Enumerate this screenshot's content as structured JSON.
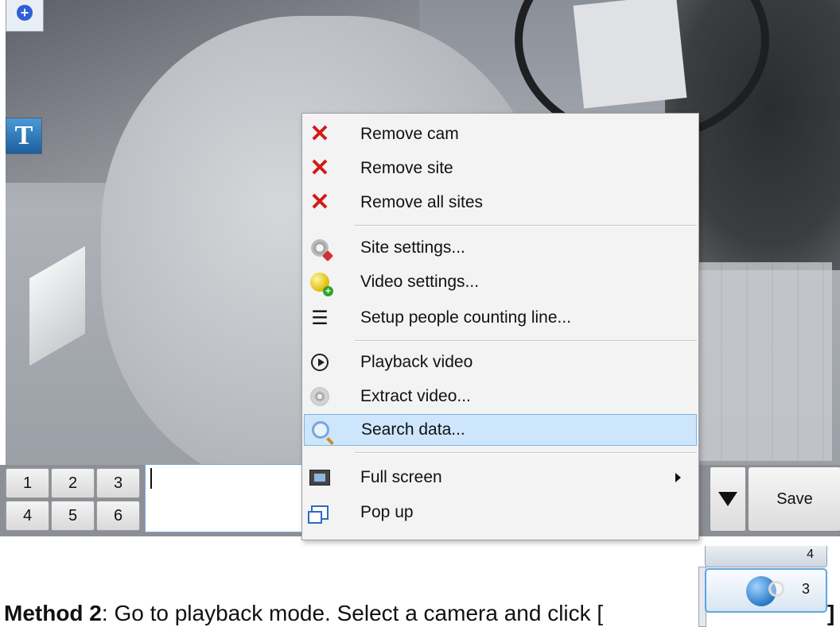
{
  "viewport": {
    "zoom_icon_symbol": "+",
    "text_tool_label": "T"
  },
  "context_menu": {
    "items": [
      {
        "label": "Remove cam",
        "icon": "close-icon"
      },
      {
        "label": "Remove site",
        "icon": "close-icon"
      },
      {
        "label": "Remove all sites",
        "icon": "close-icon"
      },
      {
        "label": "Site settings...",
        "icon": "gear-icon"
      },
      {
        "label": "Video settings...",
        "icon": "video-settings-icon"
      },
      {
        "label": "Setup people counting line...",
        "icon": "numbered-list-icon"
      },
      {
        "label": "Playback video",
        "icon": "play-icon"
      },
      {
        "label": "Extract video...",
        "icon": "disc-icon"
      },
      {
        "label": "Search data...",
        "icon": "search-icon"
      },
      {
        "label": "Full screen",
        "icon": "fullscreen-icon"
      },
      {
        "label": "Pop up",
        "icon": "popup-icon"
      }
    ],
    "highlighted": "Search data...",
    "highlight_color": "#cde6fb"
  },
  "bottom_bar": {
    "number_buttons": [
      "1",
      "2",
      "3",
      "4",
      "5",
      "6"
    ],
    "save_label": "Save"
  },
  "caption": {
    "method_label": "Method 2",
    "text": ": Go to playback mode. Select a camera and click [",
    "closing_bracket": "]"
  },
  "playback_widget": {
    "top_button_number": "4",
    "search_button_number": "3"
  }
}
